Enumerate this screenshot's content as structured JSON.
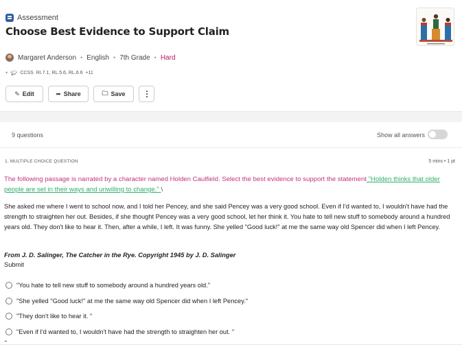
{
  "header": {
    "type_label": "Assessment",
    "title": "Choose Best Evidence to Support Claim",
    "author": "Margaret Anderson",
    "subject": "English",
    "grade": "7th Grade",
    "difficulty": "Hard",
    "standards_prefix": "CCSS",
    "standards": "RI.7.1, RL.5.6, RL.6.6",
    "standards_more": "+11",
    "separator": "•"
  },
  "actions": {
    "edit": "Edit",
    "share": "Share",
    "save": "Save"
  },
  "question_bar": {
    "count": "9 questions",
    "show_all": "Show all answers"
  },
  "question": {
    "header": "1.  MULTIPLE CHOICE QUESTION",
    "time_points": "5 mins • 1 pt",
    "prompt_main": "The following passage is narrated by a character named Holden Caulfield. Select the best evidence to support the statement",
    "prompt_claim": " \"Holden thinks that older people are set in their ways and unwilling to change.\" ",
    "prompt_tail": "\\",
    "passage": "She asked me where I went to school now, and I told her Pencey, and she said Pencey was a very good school. Even if I'd wanted to, I wouldn't have had the strength to straighten her out. Besides, if she thought Pencey was a very good school, let her think it. You hate to tell new stuff to somebody around a hundred years old. They don't like to hear it. Then, after a while, I left. It was funny. She yelled \"Good luck!\" at me the same way old Spencer did when I left Pencey.",
    "citation": "From J. D. Salinger, The Catcher in the Rye. Copyright 1945 by J. D. Salinger",
    "submit": "Submit",
    "options": [
      "\"You hate to tell new stuff to somebody around a hundred years old.\"",
      "\"She yelled \"Good luck!\" at me the same way old Spencer did when I left Pencey.\"",
      "\"They don't like to hear it. \"",
      "\"Even if I'd wanted to, I wouldn't have had the strength to straighten her out. \""
    ]
  },
  "colors": {
    "difficulty": "#b1175b",
    "prompt": "#c0357a",
    "claim": "#2fae6a",
    "type_icon": "#2e5f9e"
  },
  "icons": {
    "type": "assessment-icon",
    "avatar": "author-avatar",
    "standards": "graduation-cap-icon",
    "edit": "pencil-icon",
    "share": "share-arrow-icon",
    "save": "folder-icon",
    "more": "kebab-menu-icon"
  }
}
